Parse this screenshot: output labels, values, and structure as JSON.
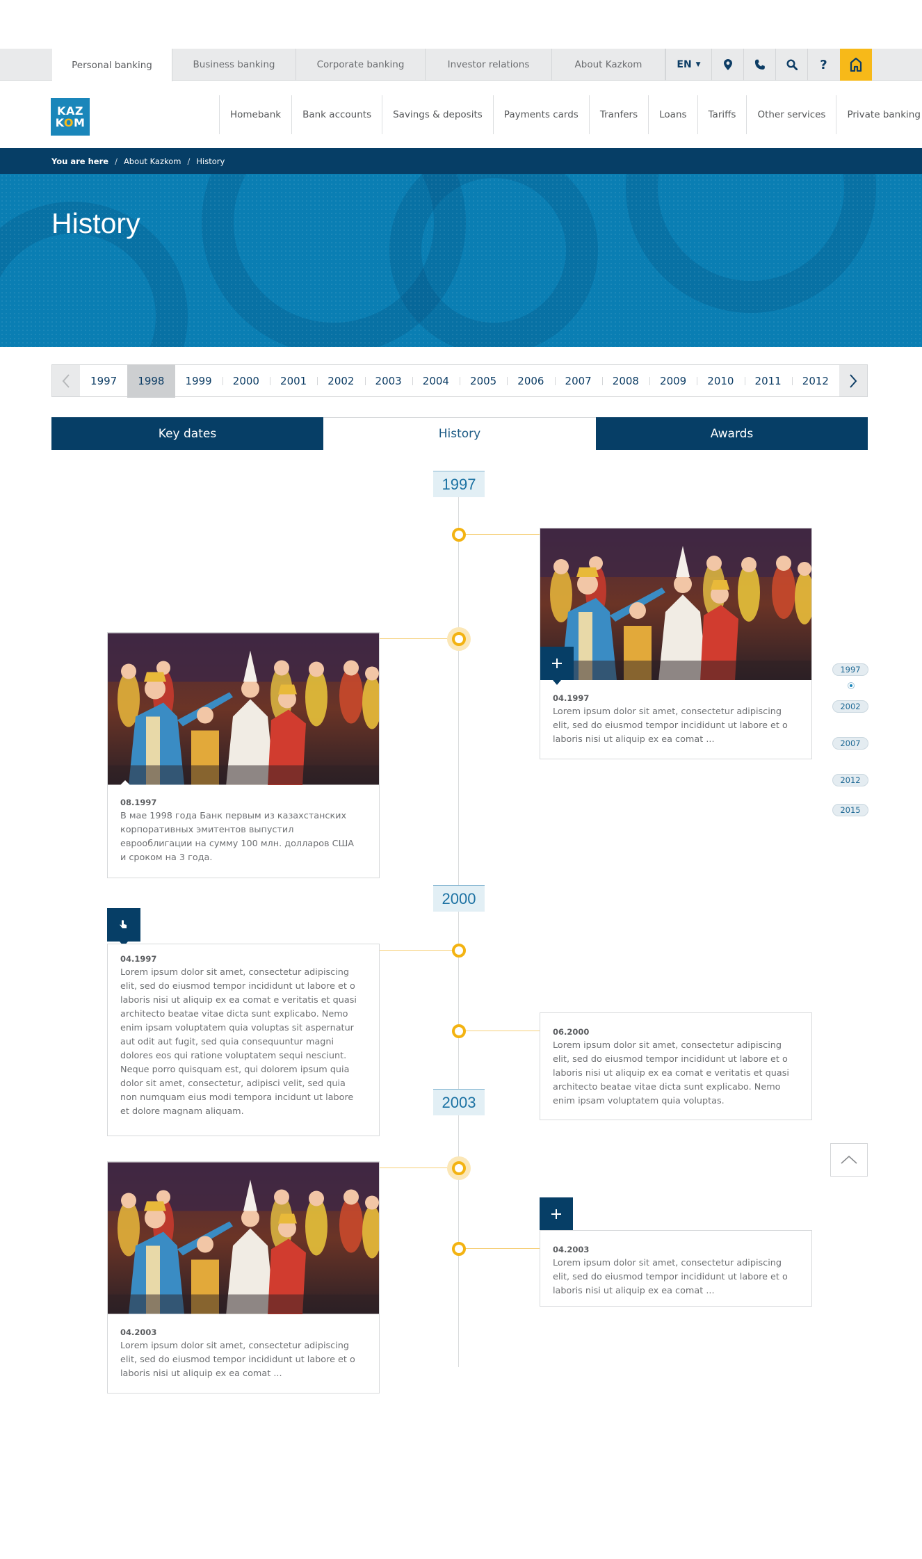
{
  "top_tabs": [
    {
      "label": "Personal banking"
    },
    {
      "label": "Business banking"
    },
    {
      "label": "Corporate banking"
    },
    {
      "label": "Investor relations"
    },
    {
      "label": "About Kazkom"
    }
  ],
  "top_tools": {
    "language": "EN",
    "icons": [
      "location-pin-icon",
      "phone-icon",
      "search-icon",
      "help-icon",
      "home-icon"
    ],
    "help_glyph": "?"
  },
  "logo": {
    "line1": "KAZ",
    "line2_a": "K",
    "line2_b": "O",
    "line2_c": "M"
  },
  "main_nav": [
    {
      "label": "Homebank"
    },
    {
      "label": "Bank accounts"
    },
    {
      "label": "Savings & deposits"
    },
    {
      "label": "Payments cards"
    },
    {
      "label": "Tranfers"
    },
    {
      "label": "Loans"
    },
    {
      "label": "Tariffs"
    },
    {
      "label": "Other services"
    },
    {
      "label": "Private banking"
    }
  ],
  "breadcrumb": {
    "here": "You are here",
    "items": [
      "About Kazkom",
      "History"
    ],
    "separator": "/"
  },
  "hero": {
    "title": "History"
  },
  "year_strip": {
    "years": [
      "1997",
      "1998",
      "1999",
      "2000",
      "2001",
      "2002",
      "2003",
      "2004",
      "2005",
      "2006",
      "2007",
      "2008",
      "2009",
      "2010",
      "2011",
      "2012"
    ],
    "active": "1998"
  },
  "section_tabs": [
    {
      "label": "Key dates",
      "active": false
    },
    {
      "label": "History",
      "active": true
    },
    {
      "label": "Awards",
      "active": false
    }
  ],
  "timeline": {
    "year_labels": [
      "1997",
      "2000",
      "2003"
    ],
    "cards": [
      {
        "date": "04.1997",
        "text": "Lorem ipsum dolor sit amet, consectetur adipiscing elit, sed do eiusmod tempor incididunt ut labore et o laboris nisi ut aliquip ex ea comat ..."
      },
      {
        "date": "08.1997",
        "text": "В мае 1998 года Банк первым из казахстанских корпоративных эмитентов выпустил еврооблигации на сумму 100 млн. долларов США и сроком на 3 года."
      },
      {
        "date": "04.1997",
        "text": "Lorem ipsum dolor sit amet, consectetur adipiscing elit, sed do eiusmod tempor incididunt ut labore et o laboris nisi ut aliquip ex ea comat e veritatis et quasi architecto beatae vitae dicta sunt explicabo. Nemo enim ipsam voluptatem quia voluptas sit aspernatur aut odit aut fugit, sed quia consequuntur magni dolores eos qui ratione voluptatem sequi nesciunt. Neque porro quisquam est, qui dolorem ipsum quia dolor sit amet, consectetur, adipisci velit, sed quia non numquam eius modi tempora incidunt ut labore et dolore magnam aliquam."
      },
      {
        "date": "06.2000",
        "text": "Lorem ipsum dolor sit amet, consectetur adipiscing elit, sed do eiusmod tempor incididunt ut labore et o laboris nisi ut aliquip ex ea comat e veritatis et quasi architecto beatae vitae dicta sunt explicabo. Nemo enim ipsam voluptatem quia voluptas."
      },
      {
        "date": "04.2003",
        "text": "Lorem ipsum dolor sit amet, consectetur adipiscing elit, sed do eiusmod tempor incididunt ut labore et o laboris nisi ut aliquip ex ea comat ..."
      },
      {
        "date": "04.2003",
        "text": "Lorem ipsum dolor sit amet, consectetur adipiscing elit, sed do eiusmod tempor incididunt ut labore et o laboris nisi ut aliquip ex ea comat ..."
      }
    ]
  },
  "mini_nav": {
    "years": [
      "1997",
      "2002",
      "2007",
      "2012",
      "2015"
    ]
  },
  "colors": {
    "navy": "#063e66",
    "blue": "#0a7eb3",
    "accent": "#f7b919",
    "node": "#f3b312"
  }
}
